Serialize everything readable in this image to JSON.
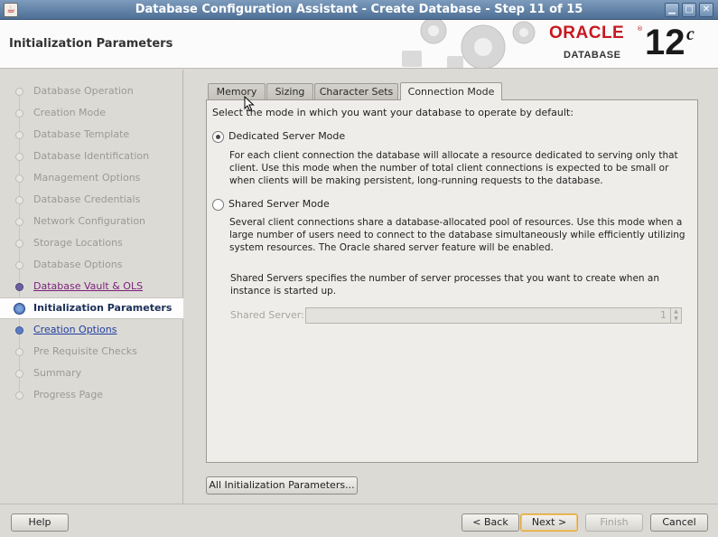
{
  "window": {
    "title": "Database Configuration Assistant - Create Database - Step 11 of 15",
    "icon": "java-icon",
    "controls": [
      "minimize-icon",
      "maximize-icon",
      "close-icon"
    ]
  },
  "header": {
    "page_title": "Initialization Parameters",
    "logo": {
      "oracle": "ORACLE",
      "registered": "®",
      "database": "DATABASE",
      "version": "12",
      "version_suffix": "c"
    }
  },
  "sidebar": {
    "steps": [
      {
        "label": "Database Operation",
        "state": "done"
      },
      {
        "label": "Creation Mode",
        "state": "done"
      },
      {
        "label": "Database Template",
        "state": "done"
      },
      {
        "label": "Database Identification",
        "state": "done"
      },
      {
        "label": "Management Options",
        "state": "done"
      },
      {
        "label": "Database Credentials",
        "state": "done"
      },
      {
        "label": "Network Configuration",
        "state": "done"
      },
      {
        "label": "Storage Locations",
        "state": "done"
      },
      {
        "label": "Database Options",
        "state": "done"
      },
      {
        "label": "Database Vault & OLS",
        "state": "visited"
      },
      {
        "label": "Initialization Parameters",
        "state": "current"
      },
      {
        "label": "Creation Options",
        "state": "next"
      },
      {
        "label": "Pre Requisite Checks",
        "state": "pending"
      },
      {
        "label": "Summary",
        "state": "pending"
      },
      {
        "label": "Progress Page",
        "state": "pending"
      }
    ]
  },
  "tabs": [
    {
      "label": "Memory",
      "active": false
    },
    {
      "label": "Sizing",
      "active": false
    },
    {
      "label": "Character Sets",
      "active": false
    },
    {
      "label": "Connection Mode",
      "active": true
    }
  ],
  "connection_mode": {
    "intro": "Select the mode in which you want your database to operate by default:",
    "dedicated": {
      "label": "Dedicated Server Mode",
      "selected": true,
      "description": "For each client connection the database will allocate a resource dedicated to serving only that client.  Use this mode when the number of total client connections is expected to be small or when clients will be making persistent, long-running requests to the database."
    },
    "shared": {
      "label": "Shared Server Mode",
      "selected": false,
      "description": "Several client connections share a database-allocated pool of resources.  Use this mode when a large number of users need to connect to the database simultaneously while efficiently utilizing system resources.  The Oracle shared server feature will be enabled."
    },
    "shared_servers_desc": "Shared Servers specifies the number of server processes that you want to create when an instance is started up.",
    "shared_server_label": "Shared Server:",
    "shared_server_value": "1"
  },
  "buttons": {
    "all_params": "All Initialization Parameters...",
    "help": "Help",
    "back": "< Back",
    "next": "Next >",
    "finish": "Finish",
    "cancel": "Cancel"
  },
  "colors": {
    "titlebar": "#5b7ca3",
    "oracle_red": "#c7181f",
    "current_step": "#1b2f57",
    "visited_link": "#7a1f7a",
    "next_link": "#1f3fa0"
  }
}
